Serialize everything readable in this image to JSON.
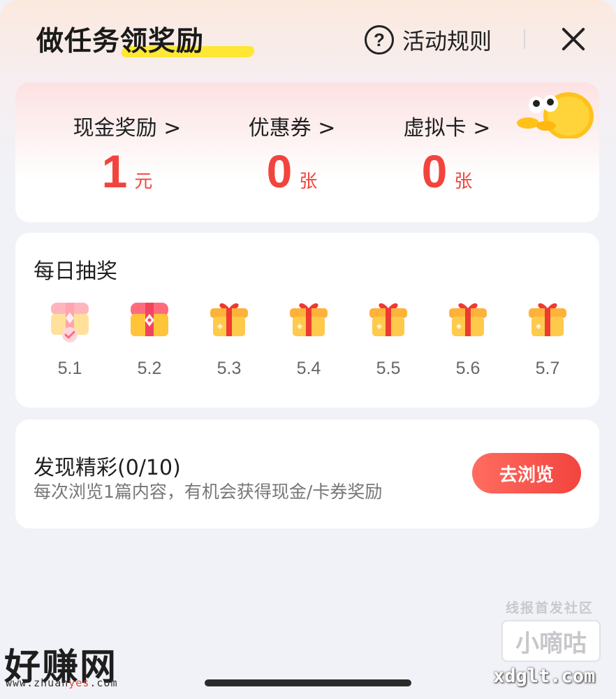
{
  "header": {
    "title": "做任务领奖励",
    "rules_label": "活动规则",
    "rules_icon": "question-circle-icon",
    "close_icon": "close-icon"
  },
  "rewards": [
    {
      "label": "现金奖励 >",
      "value": "1",
      "unit": "元"
    },
    {
      "label": "优惠券 >",
      "value": "0",
      "unit": "张"
    },
    {
      "label": "虚拟卡 >",
      "value": "0",
      "unit": "张"
    }
  ],
  "daily_draw": {
    "title": "每日抽奖",
    "days": [
      {
        "label": "5.1",
        "icon": "opened-chest-checked-icon",
        "state": "claimed"
      },
      {
        "label": "5.2",
        "icon": "treasure-chest-icon",
        "state": "available"
      },
      {
        "label": "5.3",
        "icon": "gift-box-icon",
        "state": "locked"
      },
      {
        "label": "5.4",
        "icon": "gift-box-icon",
        "state": "locked"
      },
      {
        "label": "5.5",
        "icon": "gift-box-icon",
        "state": "locked"
      },
      {
        "label": "5.6",
        "icon": "gift-box-icon",
        "state": "locked"
      },
      {
        "label": "5.7",
        "icon": "gift-box-icon",
        "state": "locked"
      }
    ]
  },
  "task": {
    "title": "发现精彩(0/10)",
    "subtitle": "每次浏览1篇内容，有机会获得现金/卡券奖励",
    "button_label": "去浏览"
  },
  "watermarks": {
    "right_top": "线报首发社区",
    "right_box": "小嘀咕",
    "right_url": "xdglt.com",
    "left_logo": "好赚网",
    "left_url_prefix": "www.zhuan",
    "left_url_highlight": "yes",
    "left_url_suffix": ".com"
  },
  "colors": {
    "accent_red": "#f2443e",
    "title_highlight": "#ffe733",
    "gift_orange": "#f9b53a",
    "ribbon_red": "#ee3a32"
  }
}
